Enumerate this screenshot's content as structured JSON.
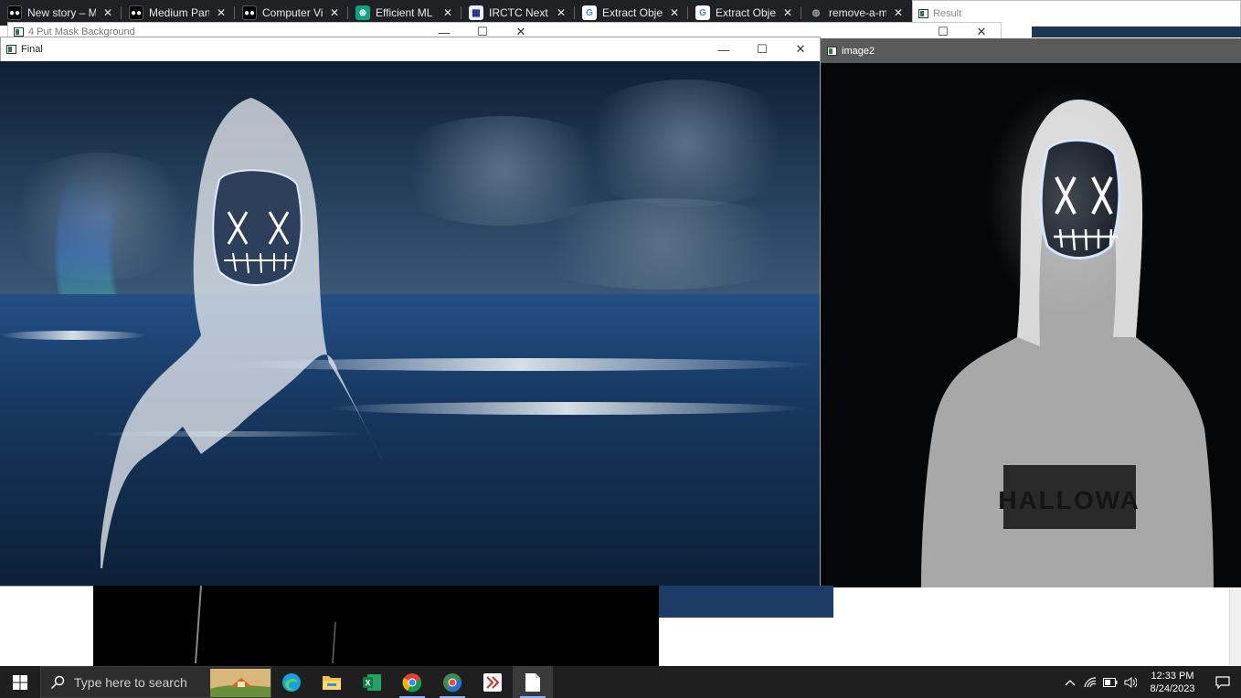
{
  "browser_tabs": [
    {
      "label": "New story – M",
      "icon": "medium-icon"
    },
    {
      "label": "Medium Partn",
      "icon": "medium-icon"
    },
    {
      "label": "Computer Visi",
      "icon": "medium-icon"
    },
    {
      "label": "Efficient ML C",
      "icon": "chatgpt-icon"
    },
    {
      "label": "IRCTC Next Ge",
      "icon": "irctc-icon"
    },
    {
      "label": "Extract Object",
      "icon": "google-icon"
    },
    {
      "label": "Extract Object",
      "icon": "google-icon"
    },
    {
      "label": "remove-a-mar",
      "icon": "globe-icon"
    }
  ],
  "windows": {
    "result": {
      "title": "Result"
    },
    "mask_background": {
      "title": "4 Put Mask Background"
    },
    "final": {
      "title": "Final"
    },
    "image2": {
      "title": "image2"
    }
  },
  "window_controls": {
    "minimize": "—",
    "maximize": "☐",
    "close": "✕"
  },
  "taskbar": {
    "search_placeholder": "Type here to search",
    "apps": [
      "edge-icon",
      "file-explorer-icon",
      "excel-icon",
      "chrome-icon",
      "chrome-beta-icon",
      "remote-icon",
      "notepad-icon"
    ],
    "clock_time": "12:33 PM",
    "clock_date": "8/24/2023"
  },
  "colors": {
    "taskbar_bg": "#1f1f1f",
    "tabstrip_bg": "#202124",
    "accent": "#8ab4f8"
  }
}
